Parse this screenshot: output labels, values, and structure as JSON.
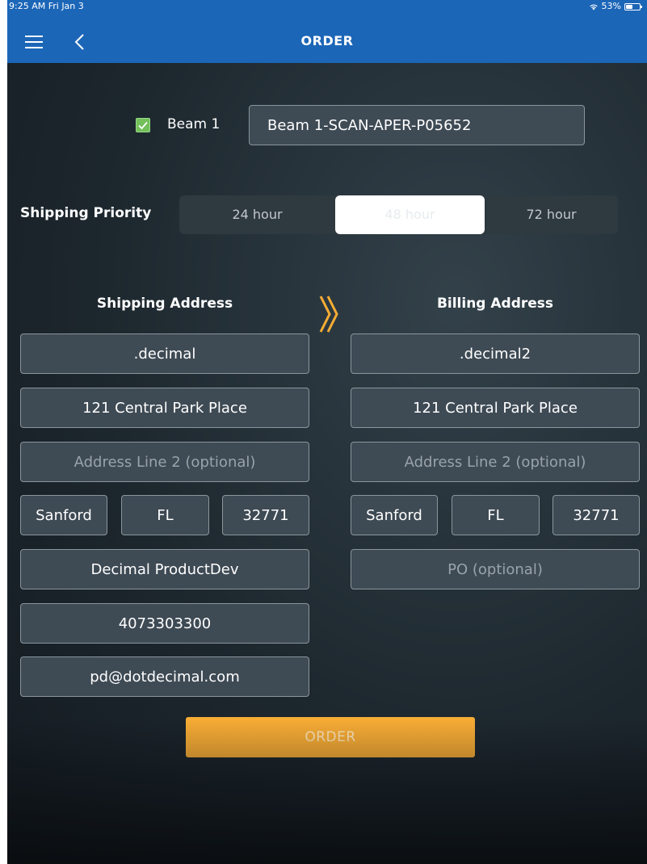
{
  "status_bar": {
    "time": "9:25 AM   Fri Jan 3",
    "battery": "53%",
    "battery_level": 0.53
  },
  "nav": {
    "title": "ORDER",
    "menu_icon": "hamburger-menu-icon",
    "back_icon": "chevron-left-icon"
  },
  "beam": {
    "label": "Beam 1",
    "checked": true,
    "value": "Beam 1-SCAN-APER-P05652"
  },
  "shipping_priority": {
    "label": "Shipping Priority",
    "options": [
      "24 hour",
      "48 hour",
      "72 hour"
    ],
    "selected": "48 hour"
  },
  "shipping": {
    "title": "Shipping Address",
    "name": ".decimal",
    "line1": "121 Central Park Place",
    "line2_placeholder": "Address Line 2 (optional)",
    "city": "Sanford",
    "state": "FL",
    "zip": "32771",
    "company": "Decimal ProductDev",
    "phone": "4073303300",
    "email": "pd@dotdecimal.com"
  },
  "copy_icon": "double-chevron-right-icon",
  "billing": {
    "title": "Billing Address",
    "name": ".decimal2",
    "line1": "121 Central Park Place",
    "line2_placeholder": "Address Line 2 (optional)",
    "city": "Sanford",
    "state": "FL",
    "zip": "32771",
    "po_placeholder": "PO (optional)"
  },
  "order_button": "ORDER",
  "colors": {
    "nav_bar": "#1c66b8",
    "accent": "#f7ac35",
    "checkbox": "#73c05a",
    "field_bg": "#3e4a54"
  }
}
